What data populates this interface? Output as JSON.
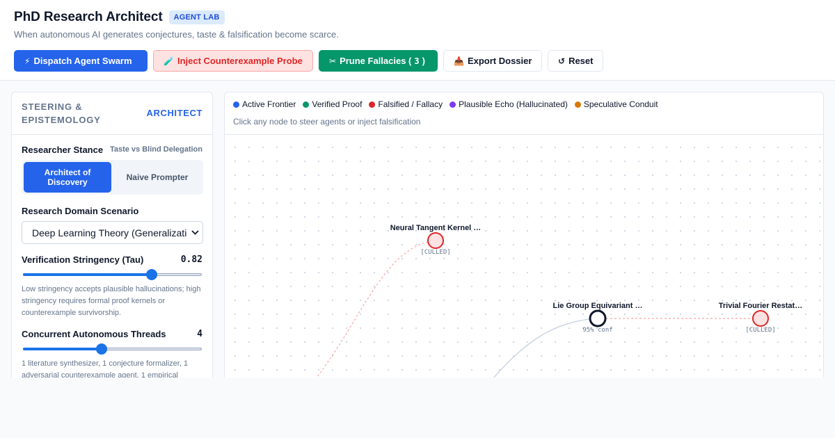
{
  "header": {
    "title": "PhD Research Architect",
    "badge": "AGENT LAB",
    "subtitle": "When autonomous AI generates conjectures, taste & falsification become scarce."
  },
  "toolbar": {
    "dispatch": {
      "icon": "⚡",
      "label": "Dispatch Agent Swarm"
    },
    "inject": {
      "icon": "🧪",
      "label": "Inject Counterexample Probe"
    },
    "prune": {
      "icon": "✂",
      "label": "Prune Fallacies (",
      "count": "3",
      "suffix": ")"
    },
    "export": {
      "icon": "📥",
      "label": "Export Dossier"
    },
    "reset": {
      "icon": "↺",
      "label": "Reset"
    }
  },
  "sidebar": {
    "title": "STEERING & EPISTEMOLOGY",
    "link": "ARCHITECT",
    "stance": {
      "label": "Researcher Stance",
      "hint": "Taste vs Blind Delegation",
      "options": [
        "Architect of Discovery",
        "Naive Prompter"
      ],
      "selected": "Architect of Discovery"
    },
    "domain": {
      "label": "Research Domain Scenario",
      "value": "Deep Learning Theory (Generalization"
    },
    "stringency": {
      "label": "Verification Stringency (Tau)",
      "value": "0.82",
      "fraction": 0.72,
      "help": "Low stringency accepts plausible hallucinations; high stringency requires formal proof kernels or counterexample survivorship."
    },
    "threads": {
      "label": "Concurrent Autonomous Threads",
      "value": "4",
      "fraction": 0.44,
      "help": "1 literature synthesizer, 1 conjecture formalizer, 1 adversarial counterexample agent, 1 empirical"
    }
  },
  "legend": [
    {
      "label": "Active Frontier",
      "color": "#2563eb"
    },
    {
      "label": "Verified Proof",
      "color": "#059669"
    },
    {
      "label": "Falsified / Fallacy",
      "color": "#dc2626"
    },
    {
      "label": "Plausible Echo (Hallucinated)",
      "color": "#7c3aed"
    },
    {
      "label": "Speculative Conduit",
      "color": "#d97706"
    }
  ],
  "graph": {
    "hint": "Click any node to steer agents or inject falsification",
    "nodes": [
      {
        "id": "ntk",
        "label": "Neural Tangent Kernel …",
        "sub": "[CULLED]",
        "status": "falsified"
      },
      {
        "id": "lie",
        "label": "Lie Group Equivariant …",
        "sub": "95% conf",
        "status": "selected"
      },
      {
        "id": "fourier",
        "label": "Trivial Fourier Restat…",
        "sub": "[CULLED]",
        "status": "falsified"
      }
    ]
  }
}
